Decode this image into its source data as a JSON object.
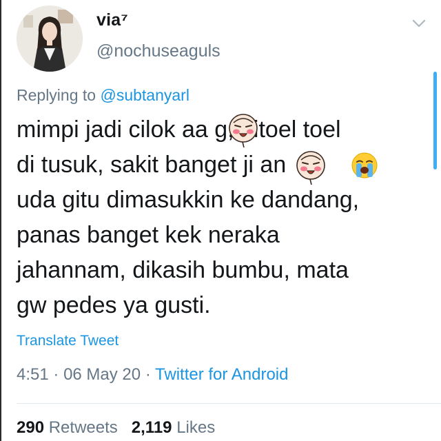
{
  "user": {
    "display_name": "via⁷",
    "handle": "@nochuseaguls"
  },
  "reply": {
    "prefix": "Replying to",
    "mention": "@subtanyarl"
  },
  "tweet": {
    "lines": [
      "mimpi jadi cilok aa g, ditoel toel",
      "di tusuk, sakit banget ji an",
      "uda gitu dimasukkin ke dandang,",
      "panas banget kek neraka",
      "jahannam, dikasih bumbu, mata",
      "gw pedes ya gusti."
    ],
    "emoji": [
      "loudly-crying-face-icon"
    ],
    "stickers": [
      "blushing-face-sticker",
      "blushing-face-sticker"
    ]
  },
  "translate_label": "Translate Tweet",
  "meta": {
    "time": "4:51",
    "sep1": "·",
    "date": "06 May 20",
    "sep2": "·",
    "source": "Twitter for Android"
  },
  "stats": {
    "retweets_count": "290",
    "retweets_label": "Retweets",
    "likes_count": "2,119",
    "likes_label": "Likes"
  },
  "colors": {
    "link": "#1b95e0",
    "secondary": "#657786",
    "primary_text": "#14171a",
    "scrollbar": "#1da1f2"
  }
}
